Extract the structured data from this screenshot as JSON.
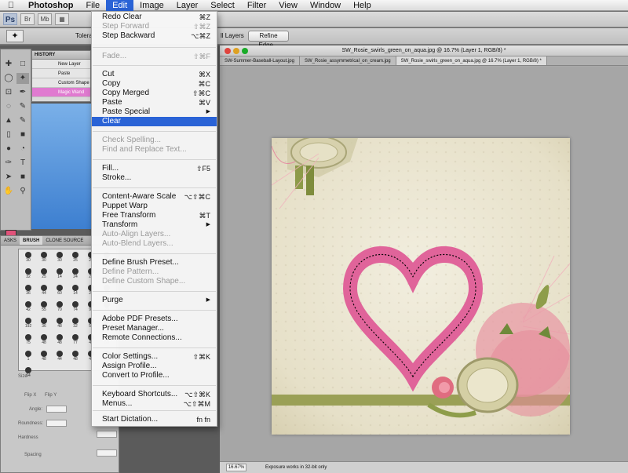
{
  "menubar": {
    "app": "Photoshop",
    "items": [
      "File",
      "Edit",
      "Image",
      "Layer",
      "Select",
      "Filter",
      "View",
      "Window",
      "Help"
    ]
  },
  "appbar": {
    "logo": "Ps",
    "btn1": "Br",
    "btn2": "Mb"
  },
  "options": {
    "tolerance_label": "Tolera",
    "all_layers_label": "ll Layers",
    "refine_edge": "Refine Edge..."
  },
  "history": {
    "title": "HISTORY",
    "items": [
      "New Layer",
      "Paste",
      "Custom Shape",
      "Magic Wand"
    ]
  },
  "brush_panel": {
    "tabs": [
      "ASKS",
      "BRUSH",
      "CLONE SOURCE"
    ],
    "sizes": [
      "30",
      "30",
      "30",
      "25",
      "25",
      "25",
      "32",
      "25",
      "14",
      "24",
      "27",
      "39",
      "36",
      "44",
      "60",
      "14",
      "26",
      "33",
      "42",
      "55",
      "70",
      "74",
      "95",
      "29",
      "192",
      "36",
      "48",
      "32",
      "55",
      "100",
      "75",
      "48",
      "48",
      "77",
      "46",
      "60",
      "1",
      "48",
      "44",
      "48",
      "46",
      "45",
      "64"
    ],
    "size_label": "Size",
    "flip_x": "Flip X",
    "flip_y": "Flip Y",
    "angle_label": "Angle:",
    "roundness_label": "Roundness:",
    "hardness_label": "Hardness",
    "spacing_label": "Spacing"
  },
  "document": {
    "title": "SW_Rosie_swirls_green_on_aqua.jpg @ 16.7% (Layer 1, RGB/8) *",
    "tabs": [
      "SW-Summer-Baseball-Layout.jpg",
      "SW_Rosie_assymmetrical_on_cream.jpg",
      "SW_Rosie_swirls_green_on_aqua.jpg @ 16.7% (Layer 1, RGB/8) *"
    ],
    "zoom": "16.67%",
    "status": "Exposure works in 32-bit only"
  },
  "edit_menu": {
    "items": [
      {
        "label": "Redo Clear",
        "shortcut": "⌘Z",
        "disabled": false
      },
      {
        "label": "Step Forward",
        "shortcut": "⇧⌘Z",
        "disabled": true
      },
      {
        "label": "Step Backward",
        "shortcut": "⌥⌘Z",
        "disabled": false
      },
      {
        "label": "Fade...",
        "shortcut": "⇧⌘F",
        "disabled": true
      },
      {
        "label": "Cut",
        "shortcut": "⌘X",
        "disabled": false
      },
      {
        "label": "Copy",
        "shortcut": "⌘C",
        "disabled": false
      },
      {
        "label": "Copy Merged",
        "shortcut": "⇧⌘C",
        "disabled": false
      },
      {
        "label": "Paste",
        "shortcut": "⌘V",
        "disabled": false
      },
      {
        "label": "Paste Special",
        "shortcut": "",
        "disabled": false,
        "submenu": true
      },
      {
        "label": "Clear",
        "shortcut": "",
        "disabled": false,
        "highlighted": true
      },
      {
        "label": "Check Spelling...",
        "shortcut": "",
        "disabled": true
      },
      {
        "label": "Find and Replace Text...",
        "shortcut": "",
        "disabled": true
      },
      {
        "label": "Fill...",
        "shortcut": "⇧F5",
        "disabled": false
      },
      {
        "label": "Stroke...",
        "shortcut": "",
        "disabled": false
      },
      {
        "label": "Content-Aware Scale",
        "shortcut": "⌥⇧⌘C",
        "disabled": false
      },
      {
        "label": "Puppet Warp",
        "shortcut": "",
        "disabled": false
      },
      {
        "label": "Free Transform",
        "shortcut": "⌘T",
        "disabled": false
      },
      {
        "label": "Transform",
        "shortcut": "",
        "disabled": false,
        "submenu": true
      },
      {
        "label": "Auto-Align Layers...",
        "shortcut": "",
        "disabled": true
      },
      {
        "label": "Auto-Blend Layers...",
        "shortcut": "",
        "disabled": true
      },
      {
        "label": "Define Brush Preset...",
        "shortcut": "",
        "disabled": false
      },
      {
        "label": "Define Pattern...",
        "shortcut": "",
        "disabled": true
      },
      {
        "label": "Define Custom Shape...",
        "shortcut": "",
        "disabled": true
      },
      {
        "label": "Purge",
        "shortcut": "",
        "disabled": false,
        "submenu": true
      },
      {
        "label": "Adobe PDF Presets...",
        "shortcut": "",
        "disabled": false
      },
      {
        "label": "Preset Manager...",
        "shortcut": "",
        "disabled": false
      },
      {
        "label": "Remote Connections...",
        "shortcut": "",
        "disabled": false
      },
      {
        "label": "Color Settings...",
        "shortcut": "⇧⌘K",
        "disabled": false
      },
      {
        "label": "Assign Profile...",
        "shortcut": "",
        "disabled": false
      },
      {
        "label": "Convert to Profile...",
        "shortcut": "",
        "disabled": false
      },
      {
        "label": "Keyboard Shortcuts...",
        "shortcut": "⌥⇧⌘K",
        "disabled": false
      },
      {
        "label": "Menus...",
        "shortcut": "⌥⇧⌘M",
        "disabled": false
      },
      {
        "label": "Start Dictation...",
        "shortcut": "fn fn",
        "disabled": false
      }
    ]
  },
  "colors": {
    "heart": "#e0649a",
    "selection_highlight": "#2a63d6",
    "foreground": "#e0527a",
    "background": "#a8e6e6"
  }
}
